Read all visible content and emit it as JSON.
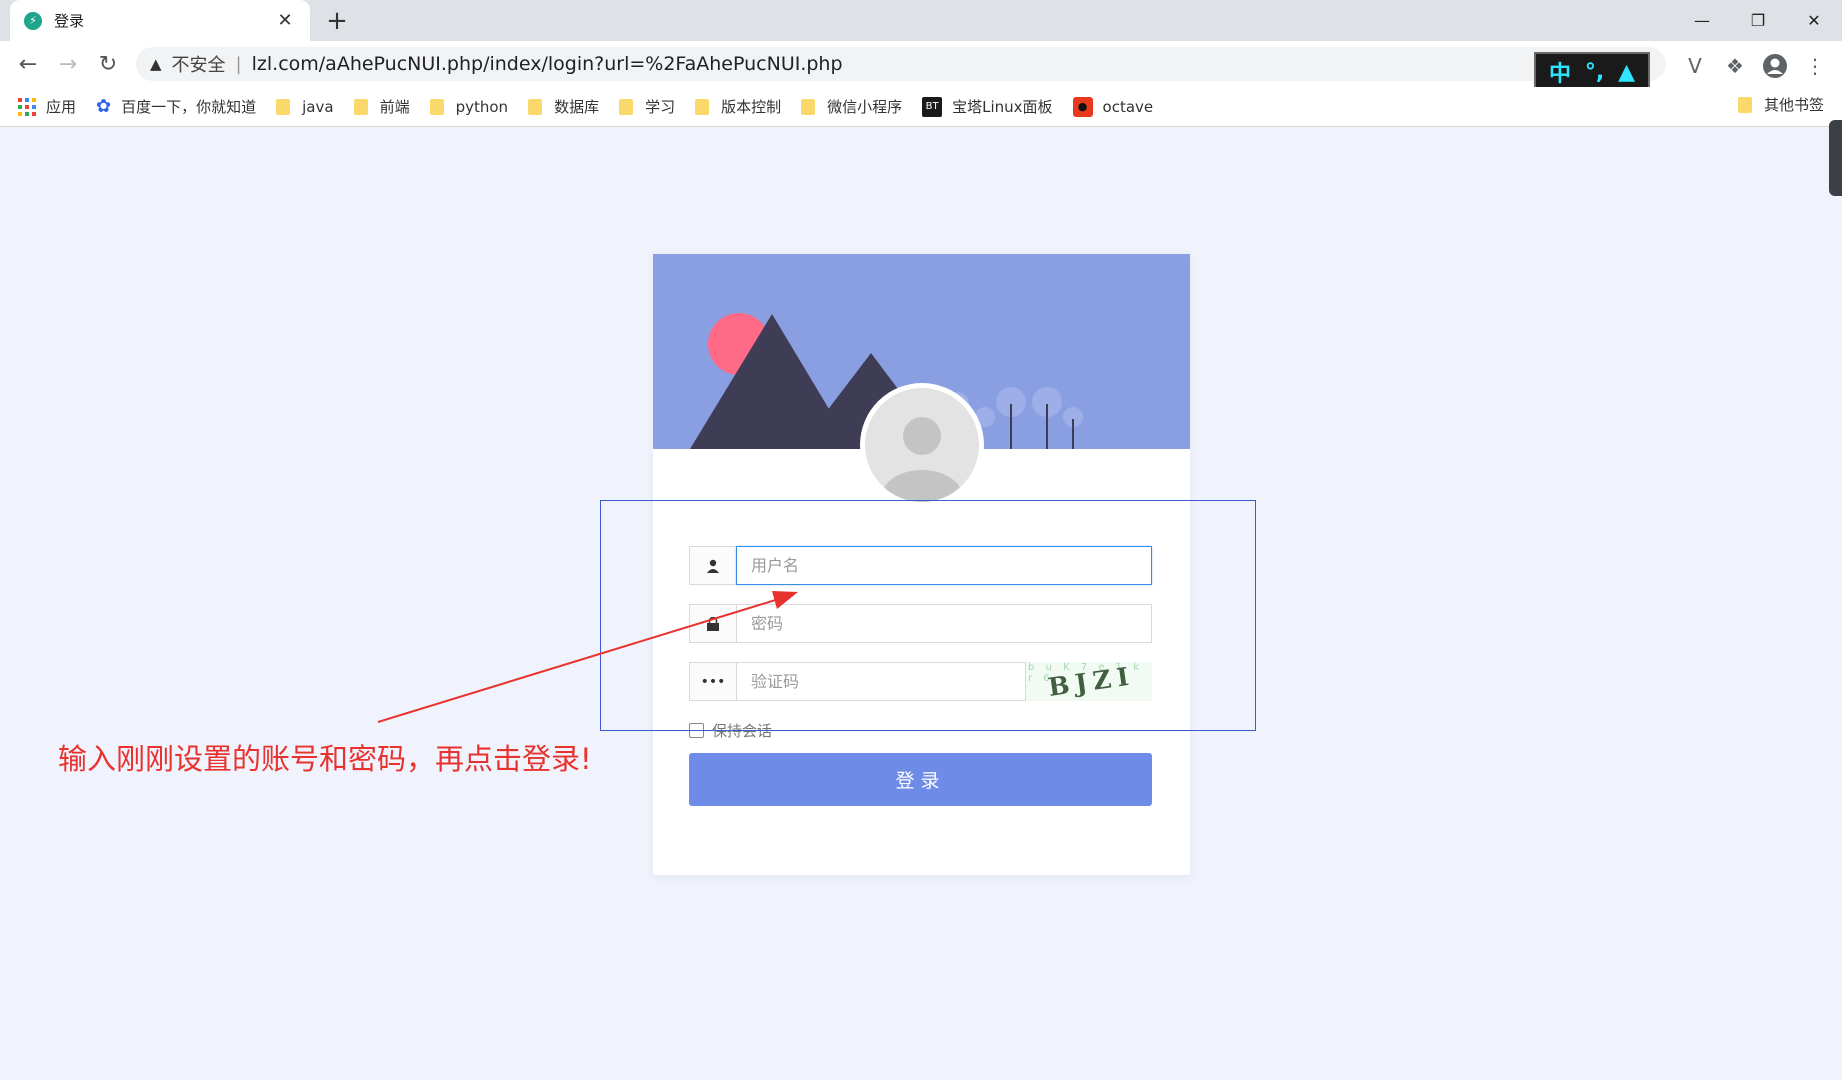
{
  "browser": {
    "tab": {
      "title": "登录",
      "favicon": "bolt-icon"
    },
    "security_label": "不安全",
    "url": "lzl.com/aAhePucNUI.php/index/login?url=%2FaAhePucNUI.php",
    "ime": {
      "mode": "中",
      "punct": "°,",
      "skin": "shirt-icon"
    },
    "bookmarks": [
      {
        "label": "应用",
        "icon": "apps-grid-icon"
      },
      {
        "label": "百度一下，你就知道",
        "icon": "baidu-paw-icon"
      },
      {
        "label": "java",
        "icon": "folder-icon"
      },
      {
        "label": "前端",
        "icon": "folder-icon"
      },
      {
        "label": "python",
        "icon": "folder-icon"
      },
      {
        "label": "数据库",
        "icon": "folder-icon"
      },
      {
        "label": "学习",
        "icon": "folder-icon"
      },
      {
        "label": "版本控制",
        "icon": "folder-icon"
      },
      {
        "label": "微信小程序",
        "icon": "folder-icon"
      },
      {
        "label": "宝塔Linux面板",
        "icon": "bt-icon",
        "badge": "BT"
      },
      {
        "label": "octave",
        "icon": "octave-icon"
      }
    ],
    "other_bookmarks": "其他书签"
  },
  "login": {
    "username_placeholder": "用户名",
    "password_placeholder": "密码",
    "captcha_placeholder": "验证码",
    "captcha_text": "BJZI",
    "captcha_noise": "b u K 7 e 1 k r 6",
    "remember_label": "保持会话",
    "submit_label": "登录"
  },
  "annotation": {
    "text": "输入刚刚设置的账号和密码，再点击登录!",
    "color": "#e8322f"
  },
  "colors": {
    "banner": "#8a9fe2",
    "accent": "#6f8be8",
    "page_bg": "#f0f3fc"
  }
}
